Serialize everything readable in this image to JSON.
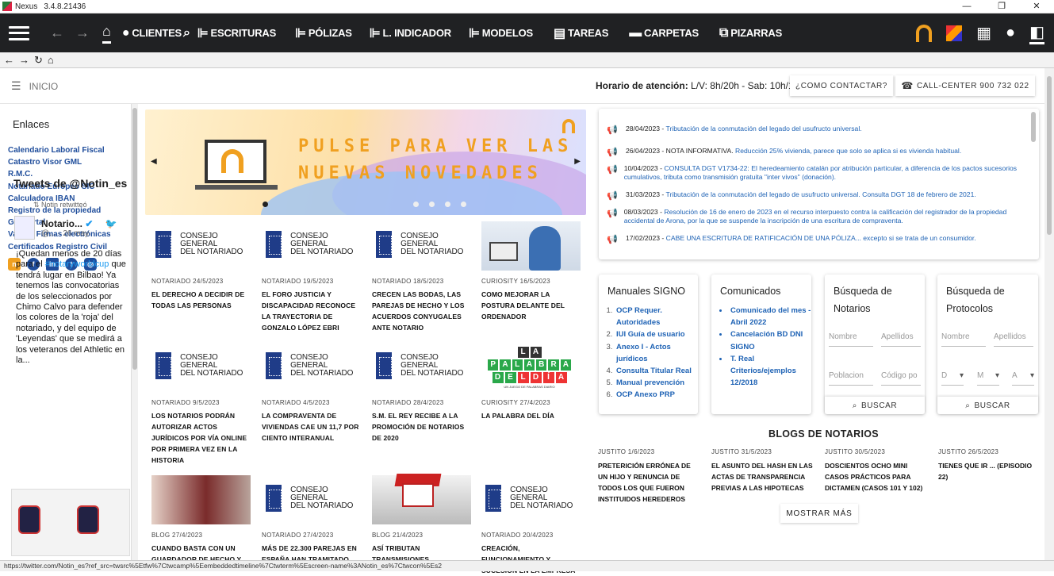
{
  "window": {
    "app": "Nexus",
    "version": "3.4.8.21436",
    "controls": [
      "—",
      "❐",
      "✕"
    ]
  },
  "nav": {
    "items": [
      {
        "label": "CLIENTES",
        "icon": "person-icon"
      },
      {
        "label": "ESCRITURAS",
        "icon": "deed-icon"
      },
      {
        "label": "PÓLIZAS",
        "icon": "policy-icon"
      },
      {
        "label": "L. INDICADOR",
        "icon": "indicator-icon"
      },
      {
        "label": "MODELOS",
        "icon": "models-icon"
      },
      {
        "label": "TAREAS",
        "icon": "tasks-icon"
      },
      {
        "label": "CARPETAS",
        "icon": "folder-icon"
      },
      {
        "label": "PIZARRAS",
        "icon": "board-icon"
      }
    ]
  },
  "header": {
    "breadcrumb": "INICIO",
    "horario_label": "Horario de atención:",
    "horario_value": "L/V: 8h/20h - Sab: 10h/13h",
    "contact_button": "¿COMO CONTACTAR?",
    "callcenter_button": "CALL-CENTER 900 732 022"
  },
  "sidebar": {
    "title": "Enlaces",
    "links": [
      "Calendario Laboral Fiscal",
      "Catastro Visor GML",
      "R.M.C.",
      "Notariado Europeo SIC",
      "Calculadora IBAN",
      "Registro de la propiedad",
      "Geoportal",
      "Validar Firmas electrónicas",
      "Certificados Registro Civil"
    ],
    "tweets_title": "Tweets de @Notin_es",
    "retweet": "Notin retwitteó",
    "tweet_user": "Notario...",
    "tweet_handle": "@... · 26 may.",
    "tweet_text_1": "¡Quedan menos de 20 días para el ",
    "tweet_hashtag": "#notaryworldcup",
    "tweet_text_2": " que tendrá lugar en Bilbao! Ya tenemos las convocatorias de los seleccionados por Chimo Calvo para defender los colores de la 'roja' del notariado, y del equipo de 'Leyendas' que se medirá a los veteranos del Athletic en la..."
  },
  "banner": {
    "line1": "PULSE PARA VER LAS",
    "line2": "NUEVAS NOVEDADES"
  },
  "cgn_text": [
    "CONSEJO GENERAL",
    "DEL NOTARIADO"
  ],
  "palabra_rows": [
    [
      "L",
      "A"
    ],
    [
      "P",
      "A",
      "L",
      "A",
      "B",
      "R",
      "A"
    ],
    [
      "D",
      "E",
      "L",
      "D",
      "Í",
      "A"
    ]
  ],
  "palabra_sub": "UN JUEGO DE PALABRAS DIARIO",
  "news": [
    {
      "meta": "NOTARIADO 24/5/2023",
      "title": "EL DERECHO A DECIDIR DE TODAS LAS PERSONAS",
      "img": "cgn"
    },
    {
      "meta": "NOTARIADO 19/5/2023",
      "title": "EL FORO JUSTICIA Y DISCAPACIDAD RECONOCE LA TRAYECTORIA DE GONZALO LÓPEZ EBRI",
      "img": "cgn"
    },
    {
      "meta": "NOTARIADO 18/5/2023",
      "title": "CRECEN LAS BODAS, LAS PAREJAS DE HECHO Y LOS ACUERDOS CONYUGALES ANTE NOTARIO",
      "img": "cgn"
    },
    {
      "meta": "CURIOSITY 16/5/2023",
      "title": "COMO MEJORAR LA POSTURA DELANTE DEL ORDENADOR",
      "img": "photo"
    },
    {
      "meta": "NOTARIADO 9/5/2023",
      "title": "LOS NOTARIOS PODRÁN AUTORIZAR ACTOS JURÍDICOS POR VÍA ONLINE POR PRIMERA VEZ EN LA HISTORIA",
      "img": "cgn"
    },
    {
      "meta": "NOTARIADO 4/5/2023",
      "title": "LA COMPRAVENTA DE VIVIENDAS CAE UN 11,7 POR CIENTO INTERANUAL",
      "img": "cgn"
    },
    {
      "meta": "NOTARIADO 28/4/2023",
      "title": "S.M. EL REY RECIBE A LA PROMOCIÓN DE NOTARIOS DE 2020",
      "img": "cgn"
    },
    {
      "meta": "CURIOSITY 27/4/2023",
      "title": "LA PALABRA DEL DÍA",
      "img": "palabra"
    },
    {
      "meta": "BLOG 27/4/2023",
      "title": "CUANDO BASTA CON UN GUARDADOR DE HECHO Y",
      "img": "hands"
    },
    {
      "meta": "NOTARIADO 27/4/2023",
      "title": "MÁS DE 22.300 PAREJAS EN ESPAÑA HAN TRAMITADO",
      "img": "cgn"
    },
    {
      "meta": "BLOG 21/4/2023",
      "title": "ASÍ TRIBUTAN TRANSMISIONES",
      "img": "house"
    },
    {
      "meta": "NOTARIADO 20/4/2023",
      "title": "CREACIÓN, FUNCIONAMIENTO Y SUCESIÓN EN LA EMPRESA",
      "img": "cgn"
    }
  ],
  "announcements": [
    {
      "date": "28/04/2023 - ",
      "plain": "",
      "link": "Tributación de la conmutación del legado del usufructo universal."
    },
    {
      "date": "26/04/2023 - ",
      "plain": "NOTA INFORMATIVA. ",
      "link": "Reducción 25% vivienda, parece que solo se aplica si es vivienda habitual."
    },
    {
      "date": "10/04/2023 - ",
      "plain": "",
      "link": "CONSULTA DGT V1734-22: El heredeamiento catalán por atribución particular, a diferencia de los pactos sucesorios cumulativos, tributa como transmisión gratuita \"inter vivos\" (donación)."
    },
    {
      "date": "31/03/2023 - ",
      "plain": "",
      "link": "Tributación de la conmutación del legado de usufructo universal. Consulta DGT 18 de febrero de 2021."
    },
    {
      "date": "08/03/2023 - ",
      "plain": "",
      "link": "Resolución de 16 de enero de 2023 en el recurso interpuesto contra la calificación del registrador de la propiedad accidental de Arona, por la que se suspende la inscripción de una escritura de compraventa."
    },
    {
      "date": "17/02/2023 - ",
      "plain": "",
      "link": "CABE UNA ESCRITURA DE RATIFICACIÓN DE UNA PÓLIZA... excepto si se trata de un consumidor."
    }
  ],
  "manuales": {
    "title": "Manuales SIGNO",
    "items": [
      "OCP Requer. Autoridades",
      "IUI Guía de usuario",
      "Anexo I - Actos jurídicos",
      "Consulta Titular Real",
      "Manual prevención",
      "OCP Anexo PRP"
    ]
  },
  "comunicados": {
    "title": "Comunicados",
    "items": [
      "Comunicado del mes - Abril 2022",
      "Cancelación BD DNI SIGNO",
      "T. Real Criterios/ejemplos 12/2018"
    ]
  },
  "busq_notarios": {
    "title": "Búsqueda de Notarios",
    "f1": "Nombre",
    "f2": "Apellidos",
    "f3": "Poblacion",
    "f4": "Código po",
    "s1": "D",
    "s2": "M",
    "s3": "A",
    "button": "BUSCAR"
  },
  "busq_protocolos": {
    "title": "Búsqueda de Protocolos",
    "f1": "Nombre",
    "f2": "Apellidos",
    "s1": "D",
    "s2": "M",
    "s3": "A",
    "button": "BUSCAR"
  },
  "blogs": {
    "title": "BLOGS DE NOTARIOS",
    "items": [
      {
        "meta": "JUSTITO 1/6/2023",
        "title": "PRETERICIÓN ERRÓNEA DE UN HIJO Y RENUNCIA DE TODOS LOS QUE FUERON INSTITUIDOS HEREDEROS"
      },
      {
        "meta": "JUSTITO 31/5/2023",
        "title": "EL ASUNTO DEL HASH EN LAS ACTAS DE TRANSPARENCIA PREVIAS A LAS HIPOTECAS"
      },
      {
        "meta": "JUSTITO 30/5/2023",
        "title": "DOSCIENTOS OCHO MINI CASOS PRÁCTICOS PARA DICTAMEN (CASOS 101 Y 102)"
      },
      {
        "meta": "JUSTITO 26/5/2023",
        "title": "TIENES QUE IR ... (EPISODIO 22)"
      }
    ],
    "more": "MOSTRAR MÁS"
  },
  "statusbar": "https://twitter.com/Notin_es?ref_src=twsrc%5Etfw%7Ctwcamp%5Eembeddedtimeline%7Ctwterm%5Escreen-name%3ANotin_es%7Ctwcon%5Es2"
}
